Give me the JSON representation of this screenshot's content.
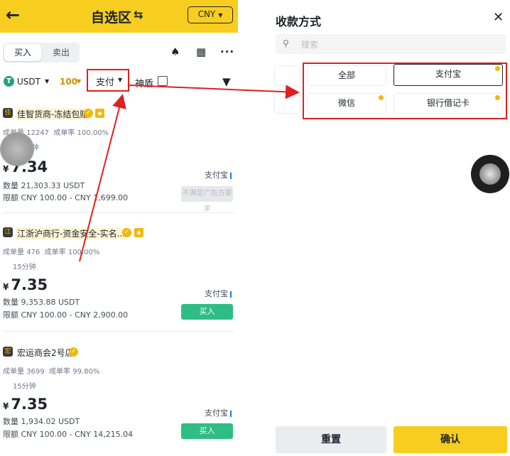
{
  "header": {
    "back_icon": "back-arrow-icon",
    "title": "自选区",
    "swap_icon": "swap-icon",
    "currency": "CNY"
  },
  "tabs": {
    "buy": "买入",
    "sell": "卖出"
  },
  "toolbar": {
    "bell_icon": "notification-icon",
    "grid_icon": "order-icon",
    "more_icon": "more-icon"
  },
  "filters": {
    "coin": "USDT",
    "amount": "100",
    "payment": "支付",
    "shield": "神盾"
  },
  "ads": [
    {
      "avatar": "佳",
      "merchant": "佳智货商-冻结包赔",
      "trades_label": "成单量",
      "trades": "12247",
      "rate_label": "成单率",
      "rate": "100.00%",
      "time": "15分钟",
      "currency_symbol": "¥",
      "price": "7.34",
      "qty": "数量 21,303.33 USDT",
      "limit": "限额 CNY 100.00 - CNY 1,699.00",
      "method": "支付宝",
      "action": "不满足广告方要求"
    },
    {
      "avatar": "江",
      "merchant": "江浙沪商行-资金安全-实名...",
      "trades_label": "成单量",
      "trades": "476",
      "rate_label": "成单率",
      "rate": "100.00%",
      "time": "15分钟",
      "currency_symbol": "¥",
      "price": "7.35",
      "qty": "数量 9,353.88 USDT",
      "limit": "限额 CNY 100.00 - CNY 2,900.00",
      "method": "支付宝",
      "action": "买入"
    },
    {
      "avatar": "宏",
      "merchant": "宏运商会2号店",
      "trades_label": "成单量",
      "trades": "3699",
      "rate_label": "成单率",
      "rate": "99.80%",
      "time": "15分钟",
      "currency_symbol": "¥",
      "price": "7.35",
      "qty": "数量 1,934.02 USDT",
      "limit": "限额 CNY 100.00 - CNY 14,215.04",
      "method": "支付宝",
      "action": "买入"
    }
  ],
  "sheet": {
    "title": "收款方式",
    "close_icon": "close-icon",
    "search_placeholder": "搜索",
    "options": [
      "全部",
      "支付宝",
      "微信",
      "银行借记卡"
    ],
    "selected": "支付宝",
    "reset": "重置",
    "confirm": "确认"
  },
  "colors": {
    "brand": "#f7cd1f",
    "buy": "#2ebd85",
    "highlight": "#e02020"
  }
}
